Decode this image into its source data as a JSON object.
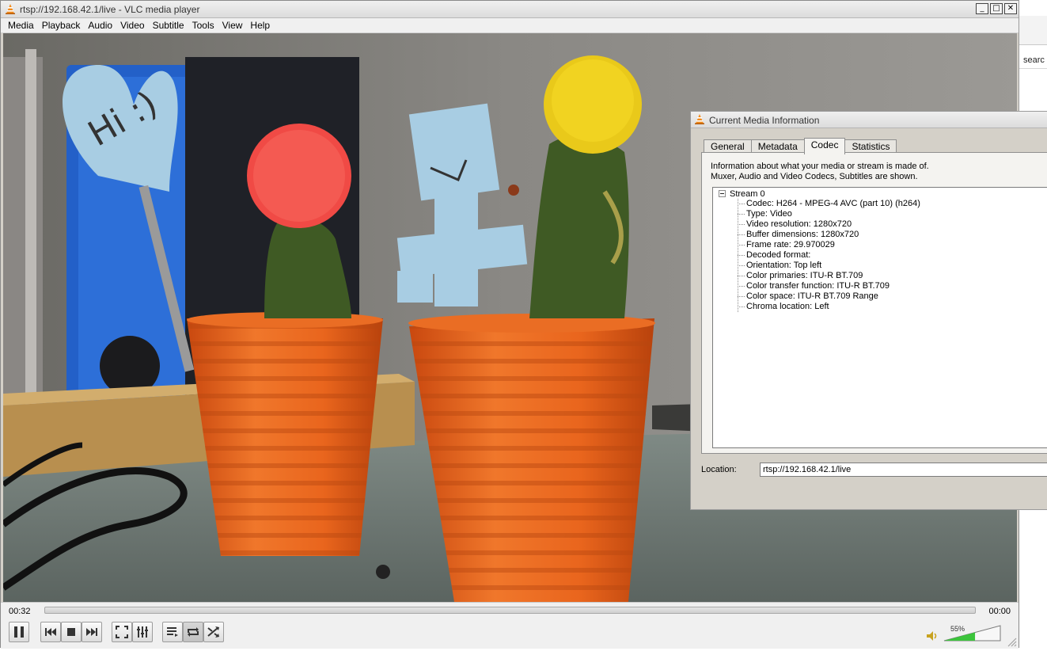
{
  "window": {
    "title": "rtsp://192.168.42.1/live - VLC media player",
    "minimize": "_",
    "maximize": "□",
    "close": "✕"
  },
  "menu": [
    "Media",
    "Playback",
    "Audio",
    "Video",
    "Subtitle",
    "Tools",
    "View",
    "Help"
  ],
  "video": {
    "sign_text": "Hi :)"
  },
  "controls": {
    "elapsed": "00:32",
    "total": "00:00",
    "volume": "55%",
    "volume_level": 0.55,
    "icons": [
      "pause-icon",
      "previous-icon",
      "stop-icon",
      "next-icon",
      "fullscreen-icon",
      "extended-settings-icon",
      "playlist-icon",
      "loop-icon",
      "shuffle-icon"
    ]
  },
  "background_window": {
    "search_text": "searc"
  },
  "media_info": {
    "title": "Current Media Information",
    "tabs": [
      "General",
      "Metadata",
      "Codec",
      "Statistics"
    ],
    "active_tab": "Codec",
    "description_line1": "Information about what your media or stream is made of.",
    "description_line2": "Muxer, Audio and Video Codecs, Subtitles are shown.",
    "stream": {
      "name": "Stream 0",
      "rows": [
        "Codec: H264 - MPEG-4 AVC (part 10) (h264)",
        "Type: Video",
        "Video resolution: 1280x720",
        "Buffer dimensions: 1280x720",
        "Frame rate: 29.970029",
        "Decoded format:",
        "Orientation: Top left",
        "Color primaries: ITU-R BT.709",
        "Color transfer function: ITU-R BT.709",
        "Color space: ITU-R BT.709 Range",
        "Chroma location: Left"
      ]
    },
    "location_label": "Location:",
    "location_value": "rtsp://192.168.42.1/live"
  },
  "colors": {
    "pot_orange": "#e9651d",
    "cactus_green": "#3f5a24",
    "red_flower": "#f04a45",
    "yellow_flower": "#f1d321",
    "paper_blue": "#a8cde3",
    "volume_green": "#3bc43b"
  }
}
